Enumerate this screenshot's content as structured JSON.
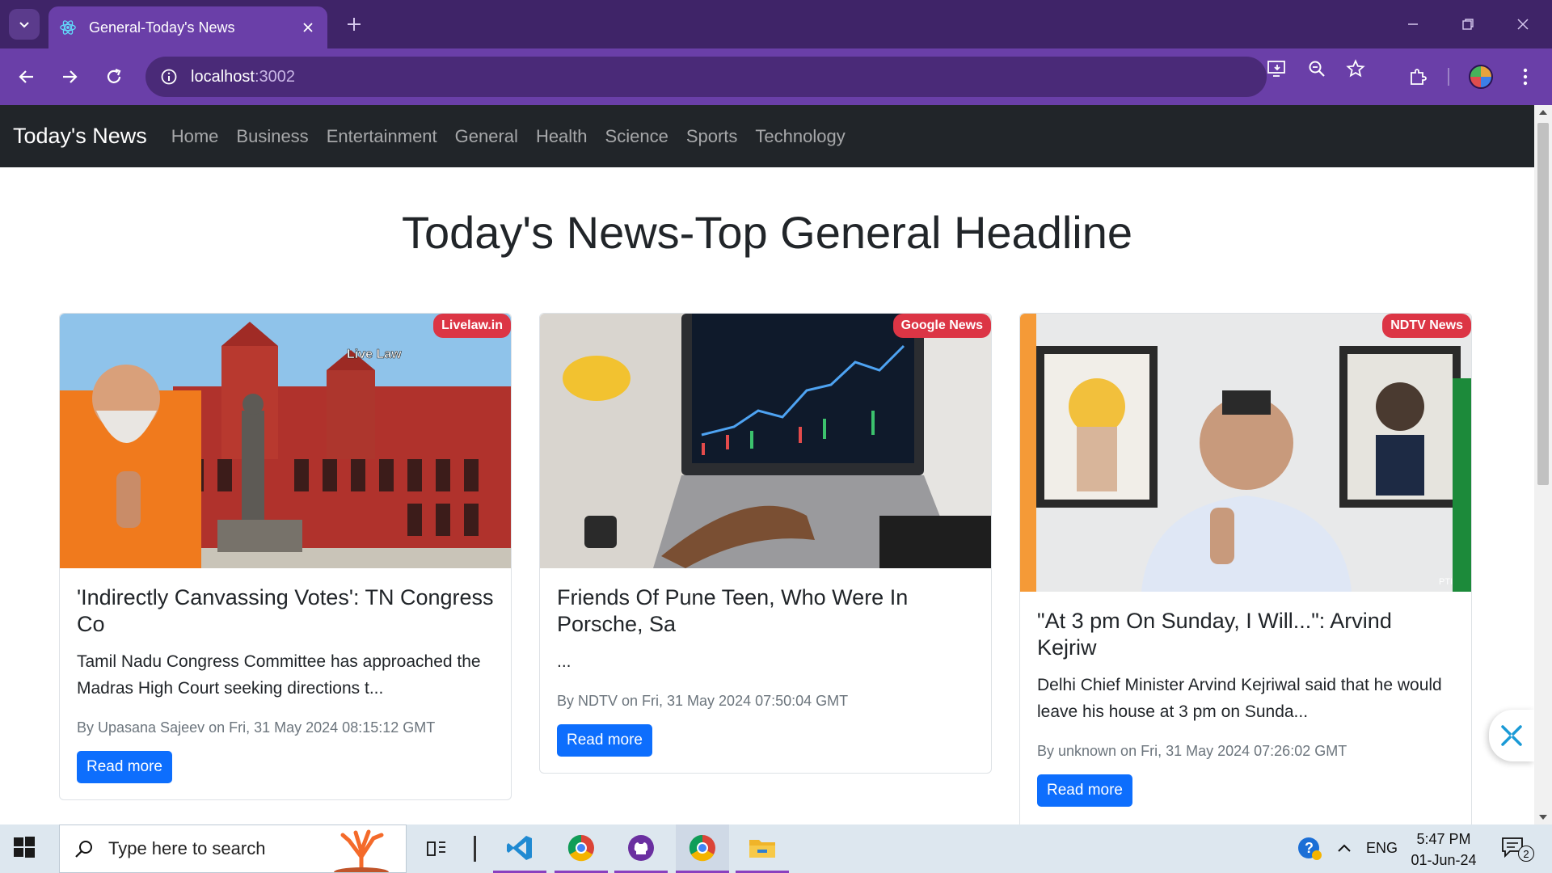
{
  "browser": {
    "tab_title": "General-Today's News",
    "url_host": "localhost",
    "url_port": ":3002"
  },
  "navbar": {
    "brand": "Today's News",
    "links": [
      "Home",
      "Business",
      "Entertainment",
      "General",
      "Health",
      "Science",
      "Sports",
      "Technology"
    ]
  },
  "page": {
    "heading": "Today's News-Top General Headline"
  },
  "cards": [
    {
      "source": "Livelaw.in",
      "title": "'Indirectly Canvassing Votes': TN Congress Co",
      "description": "Tamil Nadu Congress Committee has approached the Madras High Court seeking directions t...",
      "meta": "By Upasana Sajeev on Fri, 31 May 2024 08:15:12 GMT",
      "button": "Read more",
      "image_watermark": "Live Law"
    },
    {
      "source": "Google News",
      "title": "Friends Of Pune Teen, Who Were In Porsche, Sa",
      "description": "...",
      "meta": "By NDTV on Fri, 31 May 2024 07:50:04 GMT",
      "button": "Read more"
    },
    {
      "source": "NDTV News",
      "title": "\"At 3 pm On Sunday, I Will...\": Arvind Kejriw",
      "description": "Delhi Chief Minister Arvind Kejriwal said that he would leave his house at 3 pm on Sunda...",
      "meta": "By unknown on Fri, 31 May 2024 07:26:02 GMT",
      "button": "Read more",
      "image_watermark": "PTI"
    }
  ],
  "taskbar": {
    "search_placeholder": "Type here to search",
    "language": "ENG",
    "time": "5:47 PM",
    "date": "01-Jun-24",
    "notification_count": "2"
  },
  "colors": {
    "tabstrip": "#3f2468",
    "toolbar": "#6a3fa8",
    "navbar": "#212529",
    "badge": "#dc3545",
    "button": "#0d6efd"
  }
}
